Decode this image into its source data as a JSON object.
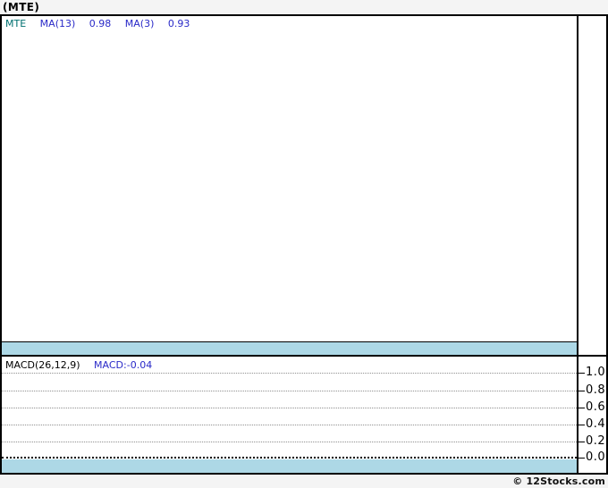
{
  "window": {
    "title": "(MTE)"
  },
  "main_panel": {
    "legend": {
      "symbol": "MTE",
      "ma13_label": "MA(13)",
      "ma13_value": "0.98",
      "ma3_label": "MA(3)",
      "ma3_value": "0.93"
    }
  },
  "macd_panel": {
    "legend": {
      "label": "MACD(26,12,9)",
      "value": "MACD:-0.04"
    },
    "yticks": [
      "1.0",
      "0.8",
      "0.6",
      "0.4",
      "0.2",
      "0.0"
    ]
  },
  "footer": {
    "copyright": "© 12Stocks.com"
  },
  "colors": {
    "background": "#f4f4f4",
    "panel_background": "#ffffff",
    "border": "#000000",
    "axis_band": "#add8e6",
    "symbol_text": "#007070",
    "indicator_text": "#2a2ac8",
    "gridline": "#909090"
  },
  "chart_data": [
    {
      "type": "line",
      "panel": "price",
      "title": "(MTE)",
      "series": [
        {
          "name": "MTE",
          "values": []
        },
        {
          "name": "MA(13)",
          "last_value": 0.98,
          "values": []
        },
        {
          "name": "MA(3)",
          "last_value": 0.93,
          "values": []
        }
      ],
      "legend_position": "top-left",
      "grid": false,
      "note": "price panel plot area is empty; only legend values are visible"
    },
    {
      "type": "line",
      "panel": "macd",
      "title": "MACD(26,12,9)",
      "series": [
        {
          "name": "MACD",
          "last_value": -0.04,
          "values": []
        }
      ],
      "yticks": [
        1.0,
        0.8,
        0.6,
        0.4,
        0.2,
        0.0
      ],
      "ylim": [
        -0.07,
        1.08
      ],
      "grid": "horizontal-dotted",
      "zero_line": "black-dotted",
      "legend_position": "top-left",
      "axis_side": "right"
    }
  ]
}
